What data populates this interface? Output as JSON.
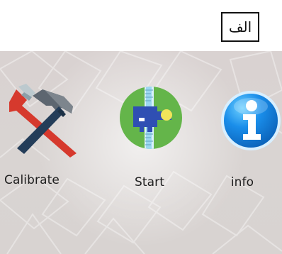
{
  "marker": {
    "text": "الف"
  },
  "apps": [
    {
      "label": "Calibrate",
      "icon": "hammer-wrench-icon"
    },
    {
      "label": "Start",
      "icon": "measuring-tool-icon"
    },
    {
      "label": "info",
      "icon": "info-icon"
    }
  ]
}
